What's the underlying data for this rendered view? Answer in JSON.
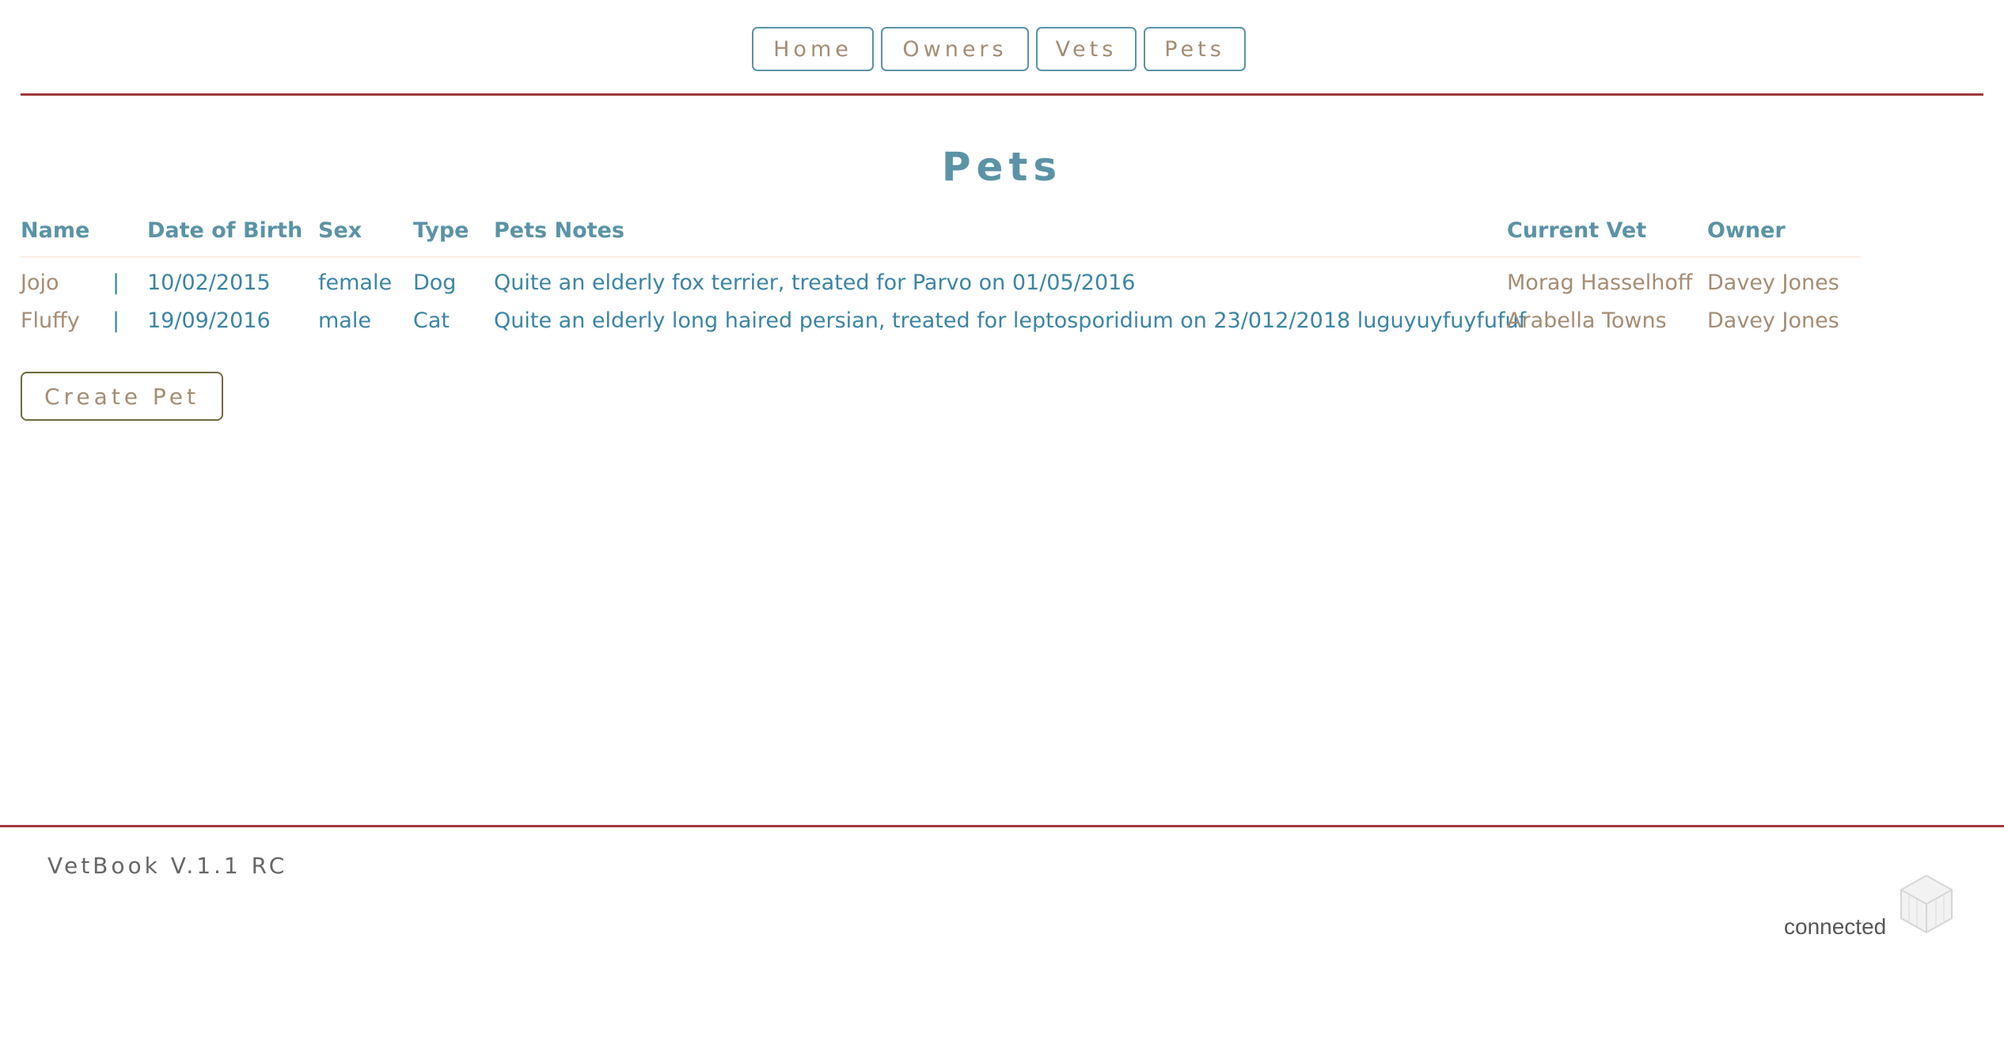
{
  "nav": {
    "items": [
      {
        "label": "Home"
      },
      {
        "label": "Owners"
      },
      {
        "label": "Vets"
      },
      {
        "label": "Pets"
      }
    ]
  },
  "page": {
    "title": "Pets"
  },
  "table": {
    "headers": {
      "name": "Name",
      "dob": "Date of Birth",
      "sex": "Sex",
      "type": "Type",
      "notes": "Pets Notes",
      "vet": "Current Vet",
      "owner": "Owner"
    },
    "rows": [
      {
        "name": "Jojo",
        "sep": "|",
        "dob": "10/02/2015",
        "sex": "female",
        "type": "Dog",
        "notes": "Quite an elderly fox terrier, treated for Parvo on 01/05/2016",
        "vet": "Morag Hasselhoff",
        "owner": "Davey Jones"
      },
      {
        "name": "Fluffy",
        "sep": "|",
        "dob": "19/09/2016",
        "sex": "male",
        "type": "Cat",
        "notes": "Quite an elderly long haired persian, treated for leptosporidium on 23/012/2018 luguyuyfuyfufuf",
        "vet": "Arabella Towns",
        "owner": "Davey Jones"
      }
    ]
  },
  "actions": {
    "create_label": "Create Pet"
  },
  "footer": {
    "version": "VetBook V.1.1 RC",
    "status": "connected",
    "status_icon": "cube-icon"
  },
  "colors": {
    "accent_teal": "#5b93a6",
    "text_tan": "#a48d74",
    "rule_red": "#a0393c"
  }
}
